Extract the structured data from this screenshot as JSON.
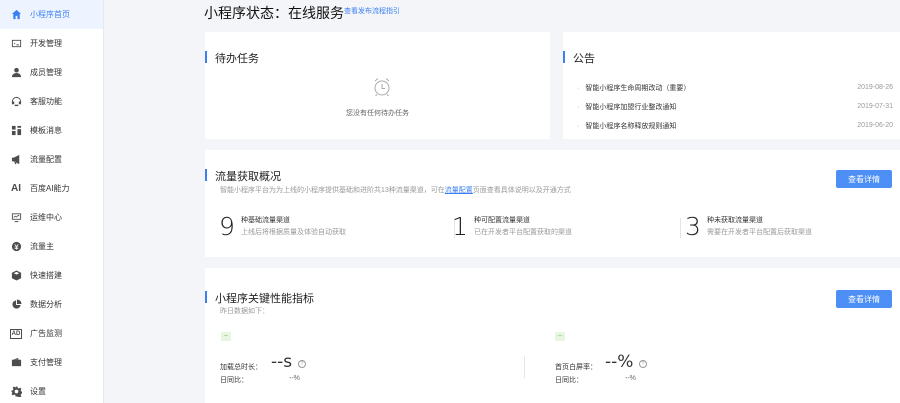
{
  "sidebar": {
    "items": [
      {
        "label": "小程序首页",
        "icon": "home-icon",
        "active": true
      },
      {
        "label": "开发管理",
        "icon": "code-icon"
      },
      {
        "label": "成员管理",
        "icon": "user-icon"
      },
      {
        "label": "客服功能",
        "icon": "headset-icon"
      },
      {
        "label": "模板消息",
        "icon": "template-icon"
      },
      {
        "label": "流量配置",
        "icon": "megaphone-icon"
      },
      {
        "label": "百度AI能力",
        "icon": "ai-icon",
        "glyph": "AI"
      },
      {
        "label": "运维中心",
        "icon": "monitor-icon"
      },
      {
        "label": "流量主",
        "icon": "coin-icon"
      },
      {
        "label": "快速搭建",
        "icon": "cube-icon"
      },
      {
        "label": "数据分析",
        "icon": "pie-chart-icon"
      },
      {
        "label": "广告监测",
        "icon": "ad-icon",
        "glyph": "AD"
      },
      {
        "label": "支付管理",
        "icon": "wallet-icon"
      },
      {
        "label": "设置",
        "icon": "gear-icon"
      }
    ]
  },
  "header": {
    "status_title": "小程序状态：在线服务",
    "status_link": "查看发布流程指引"
  },
  "todo": {
    "title": "待办任务",
    "empty_text": "您没有任何待办任务"
  },
  "notice": {
    "title": "公告",
    "items": [
      {
        "text": "智能小程序生命周期改动（重要）",
        "date": "2019-08-26"
      },
      {
        "text": "智能小程序加盟行业整改通知",
        "date": "2019-07-31"
      },
      {
        "text": "智能小程序名称释放规则通知",
        "date": "2019-06-20"
      }
    ]
  },
  "traffic": {
    "title": "流量获取概况",
    "desc_before": "智能小程序平台为为上线的小程序提供基础和进阶共13种流量渠道，可在",
    "desc_link": "流量配置",
    "desc_after": "页面查看具体说明以及开通方式",
    "button": "查看详情",
    "stats": [
      {
        "num": "9",
        "title": "种基础流量渠道",
        "sub": "上线后将根据质量及体验自动获取"
      },
      {
        "num": "1",
        "title": "种可配置流量渠道",
        "sub": "已在开发者平台配置获取的渠道"
      },
      {
        "num": "3",
        "title": "种未获取流量渠道",
        "sub": "需要在开发者平台配置后获取渠道"
      }
    ]
  },
  "perf": {
    "title": "小程序关键性能指标",
    "subtitle": "昨日数据如下：",
    "button": "查看详情",
    "tag": "--",
    "help": "?",
    "metrics": [
      {
        "label": "加载总时长：",
        "value": "--s",
        "compare_label": "日同比：",
        "compare_value": "--%"
      },
      {
        "label": "首页白屏率：",
        "value": "--%",
        "compare_label": "日同比：",
        "compare_value": "--%"
      }
    ]
  },
  "colors": {
    "accent": "#3b7ff2",
    "button": "#4d8ff5",
    "tag_bg": "#e7f6e0",
    "tag_fg": "#67b346"
  }
}
